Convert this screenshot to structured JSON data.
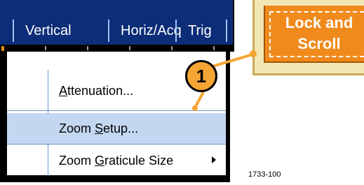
{
  "menubar": {
    "items": [
      {
        "label": "Vertical"
      },
      {
        "label": "Horiz/Acq"
      },
      {
        "label": "Trig"
      }
    ]
  },
  "dropdown": {
    "items": [
      {
        "prefix": "",
        "mnemonic": "A",
        "suffix": "ttenuation...",
        "highlighted": false,
        "submenu": false
      },
      {
        "prefix": "Zoom ",
        "mnemonic": "S",
        "suffix": "etup...",
        "highlighted": true,
        "submenu": false
      },
      {
        "prefix": "Zoom ",
        "mnemonic": "G",
        "suffix": "raticule Size",
        "highlighted": false,
        "submenu": true
      }
    ]
  },
  "lock_scroll_button": {
    "line1": "Lock and",
    "line2": "Scroll"
  },
  "callout": {
    "number": "1"
  },
  "figure_id": "1733-100",
  "colors": {
    "menubar_bg": "#0c2d78",
    "highlight": "#c3d8f0",
    "button_orange": "#f08a1c",
    "callout_fill": "#f4a534"
  }
}
